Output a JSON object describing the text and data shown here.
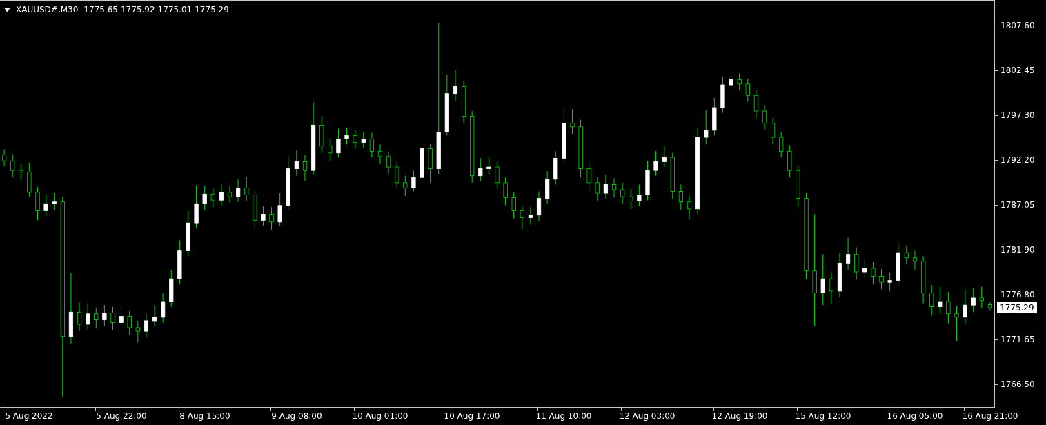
{
  "header": {
    "symbol": "XAUUSD#,M30",
    "prices": [
      "1775.65",
      "1775.92",
      "1775.01",
      "1775.29"
    ]
  },
  "chart_data": {
    "type": "candlestick",
    "categories": [
      null,
      null,
      null,
      "5 Aug 2022",
      null,
      null,
      null,
      null,
      null,
      null,
      null,
      null,
      null,
      null,
      "5 Aug 22:00",
      null,
      null,
      null,
      null,
      null,
      null,
      null,
      null,
      null,
      "8 Aug 15:00",
      null,
      null,
      null,
      null,
      null,
      null,
      null,
      null,
      null,
      null,
      "9 Aug 08:00",
      null,
      null,
      null,
      null,
      null,
      null,
      null,
      null,
      null,
      "10 Aug 01:00",
      null,
      null,
      null,
      null,
      null,
      null,
      null,
      null,
      null,
      null,
      "10 Aug 17:00",
      null,
      null,
      null,
      null,
      null,
      null,
      null,
      null,
      null,
      null,
      "11 Aug 10:00",
      null,
      null,
      null,
      null,
      null,
      null,
      null,
      null,
      null,
      "12 Aug 03:00",
      null,
      null,
      null,
      null,
      null,
      null,
      null,
      null,
      null,
      null,
      "12 Aug 19:00",
      null,
      null,
      null,
      null,
      null,
      null,
      null,
      null,
      null,
      "15 Aug 12:00",
      null,
      null,
      null,
      null,
      null,
      null,
      null,
      null,
      null,
      null,
      "16 Aug 05:00",
      null,
      null,
      null,
      null,
      null,
      null,
      null,
      null,
      "16 Aug 21:00"
    ],
    "ohlc": [
      [
        1792.8,
        1793.4,
        1791.5,
        1792.1
      ],
      [
        1792.1,
        1792.9,
        1790.2,
        1791.0
      ],
      [
        1791.0,
        1791.8,
        1789.9,
        1790.8
      ],
      [
        1790.8,
        1791.9,
        1788.0,
        1788.5
      ],
      [
        1788.5,
        1789.1,
        1785.3,
        1786.4
      ],
      [
        1786.4,
        1788.3,
        1785.8,
        1787.2
      ],
      [
        1787.2,
        1788.4,
        1786.5,
        1787.4
      ],
      [
        1787.4,
        1788.0,
        1765.0,
        1772.0
      ],
      [
        1772.0,
        1779.3,
        1771.2,
        1774.8
      ],
      [
        1774.8,
        1775.9,
        1772.6,
        1773.4
      ],
      [
        1773.4,
        1775.8,
        1772.8,
        1774.6
      ],
      [
        1774.6,
        1775.3,
        1772.9,
        1773.9
      ],
      [
        1773.9,
        1775.6,
        1773.2,
        1774.7
      ],
      [
        1774.7,
        1775.4,
        1772.7,
        1773.6
      ],
      [
        1773.6,
        1775.5,
        1773.0,
        1774.3
      ],
      [
        1774.3,
        1774.9,
        1772.2,
        1773.0
      ],
      [
        1773.0,
        1773.8,
        1771.3,
        1772.6
      ],
      [
        1772.6,
        1774.6,
        1771.9,
        1773.8
      ],
      [
        1773.8,
        1775.6,
        1773.2,
        1774.2
      ],
      [
        1774.2,
        1777.0,
        1773.6,
        1776.0
      ],
      [
        1776.0,
        1779.6,
        1775.4,
        1778.6
      ],
      [
        1778.6,
        1783.0,
        1778.0,
        1781.8
      ],
      [
        1781.8,
        1786.4,
        1781.2,
        1785.0
      ],
      [
        1785.0,
        1789.3,
        1784.4,
        1787.2
      ],
      [
        1787.2,
        1789.2,
        1786.5,
        1788.3
      ],
      [
        1788.3,
        1789.0,
        1786.8,
        1787.6
      ],
      [
        1787.6,
        1789.4,
        1787.0,
        1788.5
      ],
      [
        1788.5,
        1789.2,
        1787.3,
        1788.0
      ],
      [
        1788.0,
        1790.0,
        1787.4,
        1789.0
      ],
      [
        1789.0,
        1790.3,
        1787.5,
        1788.2
      ],
      [
        1788.2,
        1788.8,
        1784.1,
        1785.3
      ],
      [
        1785.3,
        1786.9,
        1784.7,
        1786.0
      ],
      [
        1786.0,
        1786.8,
        1784.2,
        1785.1
      ],
      [
        1785.1,
        1788.4,
        1784.6,
        1787.0
      ],
      [
        1787.0,
        1792.6,
        1786.5,
        1791.2
      ],
      [
        1791.2,
        1793.3,
        1790.4,
        1792.0
      ],
      [
        1792.0,
        1792.8,
        1789.8,
        1791.0
      ],
      [
        1791.0,
        1798.8,
        1790.5,
        1796.2
      ],
      [
        1796.2,
        1797.2,
        1793.0,
        1793.8
      ],
      [
        1793.8,
        1794.6,
        1792.1,
        1793.0
      ],
      [
        1793.0,
        1795.8,
        1792.5,
        1794.6
      ],
      [
        1794.6,
        1795.9,
        1794.0,
        1795.0
      ],
      [
        1795.0,
        1795.6,
        1793.5,
        1794.2
      ],
      [
        1794.2,
        1795.4,
        1793.6,
        1794.6
      ],
      [
        1794.6,
        1795.3,
        1792.5,
        1793.2
      ],
      [
        1793.2,
        1794.0,
        1791.8,
        1792.6
      ],
      [
        1792.6,
        1793.1,
        1790.6,
        1791.4
      ],
      [
        1791.4,
        1792.0,
        1788.9,
        1789.6
      ],
      [
        1789.6,
        1790.4,
        1788.1,
        1789.0
      ],
      [
        1789.0,
        1791.0,
        1788.6,
        1790.2
      ],
      [
        1790.2,
        1795.0,
        1789.7,
        1793.5
      ],
      [
        1793.5,
        1794.1,
        1789.6,
        1791.2
      ],
      [
        1791.2,
        1807.9,
        1790.6,
        1795.4
      ],
      [
        1795.4,
        1802.0,
        1795.0,
        1799.8
      ],
      [
        1799.8,
        1802.5,
        1799.0,
        1800.6
      ],
      [
        1800.6,
        1801.2,
        1796.4,
        1797.2
      ],
      [
        1797.2,
        1797.8,
        1789.6,
        1790.4
      ],
      [
        1790.4,
        1792.4,
        1789.8,
        1791.2
      ],
      [
        1791.2,
        1792.6,
        1790.5,
        1791.4
      ],
      [
        1791.4,
        1792.0,
        1788.9,
        1789.6
      ],
      [
        1789.6,
        1790.2,
        1787.0,
        1787.9
      ],
      [
        1787.9,
        1788.5,
        1785.5,
        1786.4
      ],
      [
        1786.4,
        1787.0,
        1784.3,
        1785.6
      ],
      [
        1785.6,
        1786.8,
        1784.8,
        1785.9
      ],
      [
        1785.9,
        1788.6,
        1785.2,
        1787.8
      ],
      [
        1787.8,
        1790.9,
        1787.2,
        1790.0
      ],
      [
        1790.0,
        1793.2,
        1789.4,
        1792.4
      ],
      [
        1792.4,
        1798.3,
        1791.9,
        1796.4
      ],
      [
        1796.4,
        1798.0,
        1795.2,
        1796.0
      ],
      [
        1796.0,
        1796.8,
        1790.2,
        1791.2
      ],
      [
        1791.2,
        1792.1,
        1788.6,
        1789.6
      ],
      [
        1789.6,
        1790.3,
        1787.5,
        1788.4
      ],
      [
        1788.4,
        1790.5,
        1787.8,
        1789.4
      ],
      [
        1789.4,
        1790.1,
        1787.9,
        1788.8
      ],
      [
        1788.8,
        1789.6,
        1787.2,
        1788.0
      ],
      [
        1788.0,
        1788.9,
        1786.6,
        1787.5
      ],
      [
        1787.5,
        1789.4,
        1786.9,
        1788.2
      ],
      [
        1788.2,
        1792.1,
        1787.6,
        1791.0
      ],
      [
        1791.0,
        1793.2,
        1790.4,
        1792.0
      ],
      [
        1792.0,
        1793.8,
        1791.4,
        1792.5
      ],
      [
        1792.5,
        1793.0,
        1787.8,
        1788.6
      ],
      [
        1788.6,
        1789.4,
        1786.5,
        1787.4
      ],
      [
        1787.4,
        1788.1,
        1785.4,
        1786.6
      ],
      [
        1786.6,
        1795.9,
        1786.0,
        1794.8
      ],
      [
        1794.8,
        1797.9,
        1794.0,
        1795.6
      ],
      [
        1795.6,
        1799.3,
        1795.0,
        1798.2
      ],
      [
        1798.2,
        1801.7,
        1797.6,
        1800.8
      ],
      [
        1800.8,
        1802.2,
        1800.1,
        1801.4
      ],
      [
        1801.4,
        1802.1,
        1800.2,
        1800.9
      ],
      [
        1800.9,
        1801.5,
        1798.9,
        1799.6
      ],
      [
        1799.6,
        1800.2,
        1797.0,
        1797.8
      ],
      [
        1797.8,
        1798.5,
        1795.7,
        1796.4
      ],
      [
        1796.4,
        1797.0,
        1794.0,
        1794.8
      ],
      [
        1794.8,
        1795.4,
        1792.5,
        1793.2
      ],
      [
        1793.2,
        1793.9,
        1790.2,
        1791.0
      ],
      [
        1791.0,
        1791.6,
        1786.9,
        1787.8
      ],
      [
        1787.8,
        1788.4,
        1778.6,
        1779.5
      ],
      [
        1779.5,
        1786.0,
        1773.2,
        1777.0
      ],
      [
        1777.0,
        1781.4,
        1775.6,
        1778.6
      ],
      [
        1778.6,
        1779.4,
        1775.8,
        1777.2
      ],
      [
        1777.2,
        1781.6,
        1776.5,
        1780.4
      ],
      [
        1780.4,
        1783.3,
        1779.6,
        1781.4
      ],
      [
        1781.4,
        1782.2,
        1778.5,
        1779.4
      ],
      [
        1779.4,
        1780.9,
        1778.7,
        1779.8
      ],
      [
        1779.8,
        1780.5,
        1778.0,
        1778.9
      ],
      [
        1778.9,
        1779.7,
        1777.4,
        1778.2
      ],
      [
        1778.2,
        1779.3,
        1777.2,
        1778.4
      ],
      [
        1778.4,
        1782.8,
        1777.9,
        1781.6
      ],
      [
        1781.6,
        1782.4,
        1780.3,
        1781.0
      ],
      [
        1781.0,
        1781.8,
        1779.6,
        1780.6
      ],
      [
        1780.6,
        1781.2,
        1775.8,
        1777.0
      ],
      [
        1777.0,
        1777.9,
        1774.4,
        1775.4
      ],
      [
        1775.4,
        1777.7,
        1774.6,
        1776.0
      ],
      [
        1776.0,
        1777.1,
        1773.5,
        1774.6
      ],
      [
        1774.6,
        1775.5,
        1771.5,
        1774.2
      ],
      [
        1774.2,
        1777.4,
        1773.4,
        1775.6
      ],
      [
        1775.6,
        1777.5,
        1774.8,
        1776.4
      ],
      [
        1776.4,
        1777.7,
        1775.2,
        1776.1
      ],
      [
        1775.65,
        1775.92,
        1775.01,
        1775.29
      ]
    ],
    "ylim": [
      1763.92,
      1810.44
    ],
    "yticks": [
      {
        "value": 1807.6,
        "label": "1807.60"
      },
      {
        "value": 1802.45,
        "label": "1802.45"
      },
      {
        "value": 1797.3,
        "label": "1797.30"
      },
      {
        "value": 1792.2,
        "label": "1792.20"
      },
      {
        "value": 1787.05,
        "label": "1787.05"
      },
      {
        "value": 1781.9,
        "label": "1781.90"
      },
      {
        "value": 1776.8,
        "label": "1776.80"
      },
      {
        "value": 1771.65,
        "label": "1771.65"
      },
      {
        "value": 1766.5,
        "label": "1766.50"
      }
    ],
    "ref_lines": [
      {
        "axis": "y",
        "value": 1775.29,
        "label": "1775.29"
      }
    ]
  }
}
